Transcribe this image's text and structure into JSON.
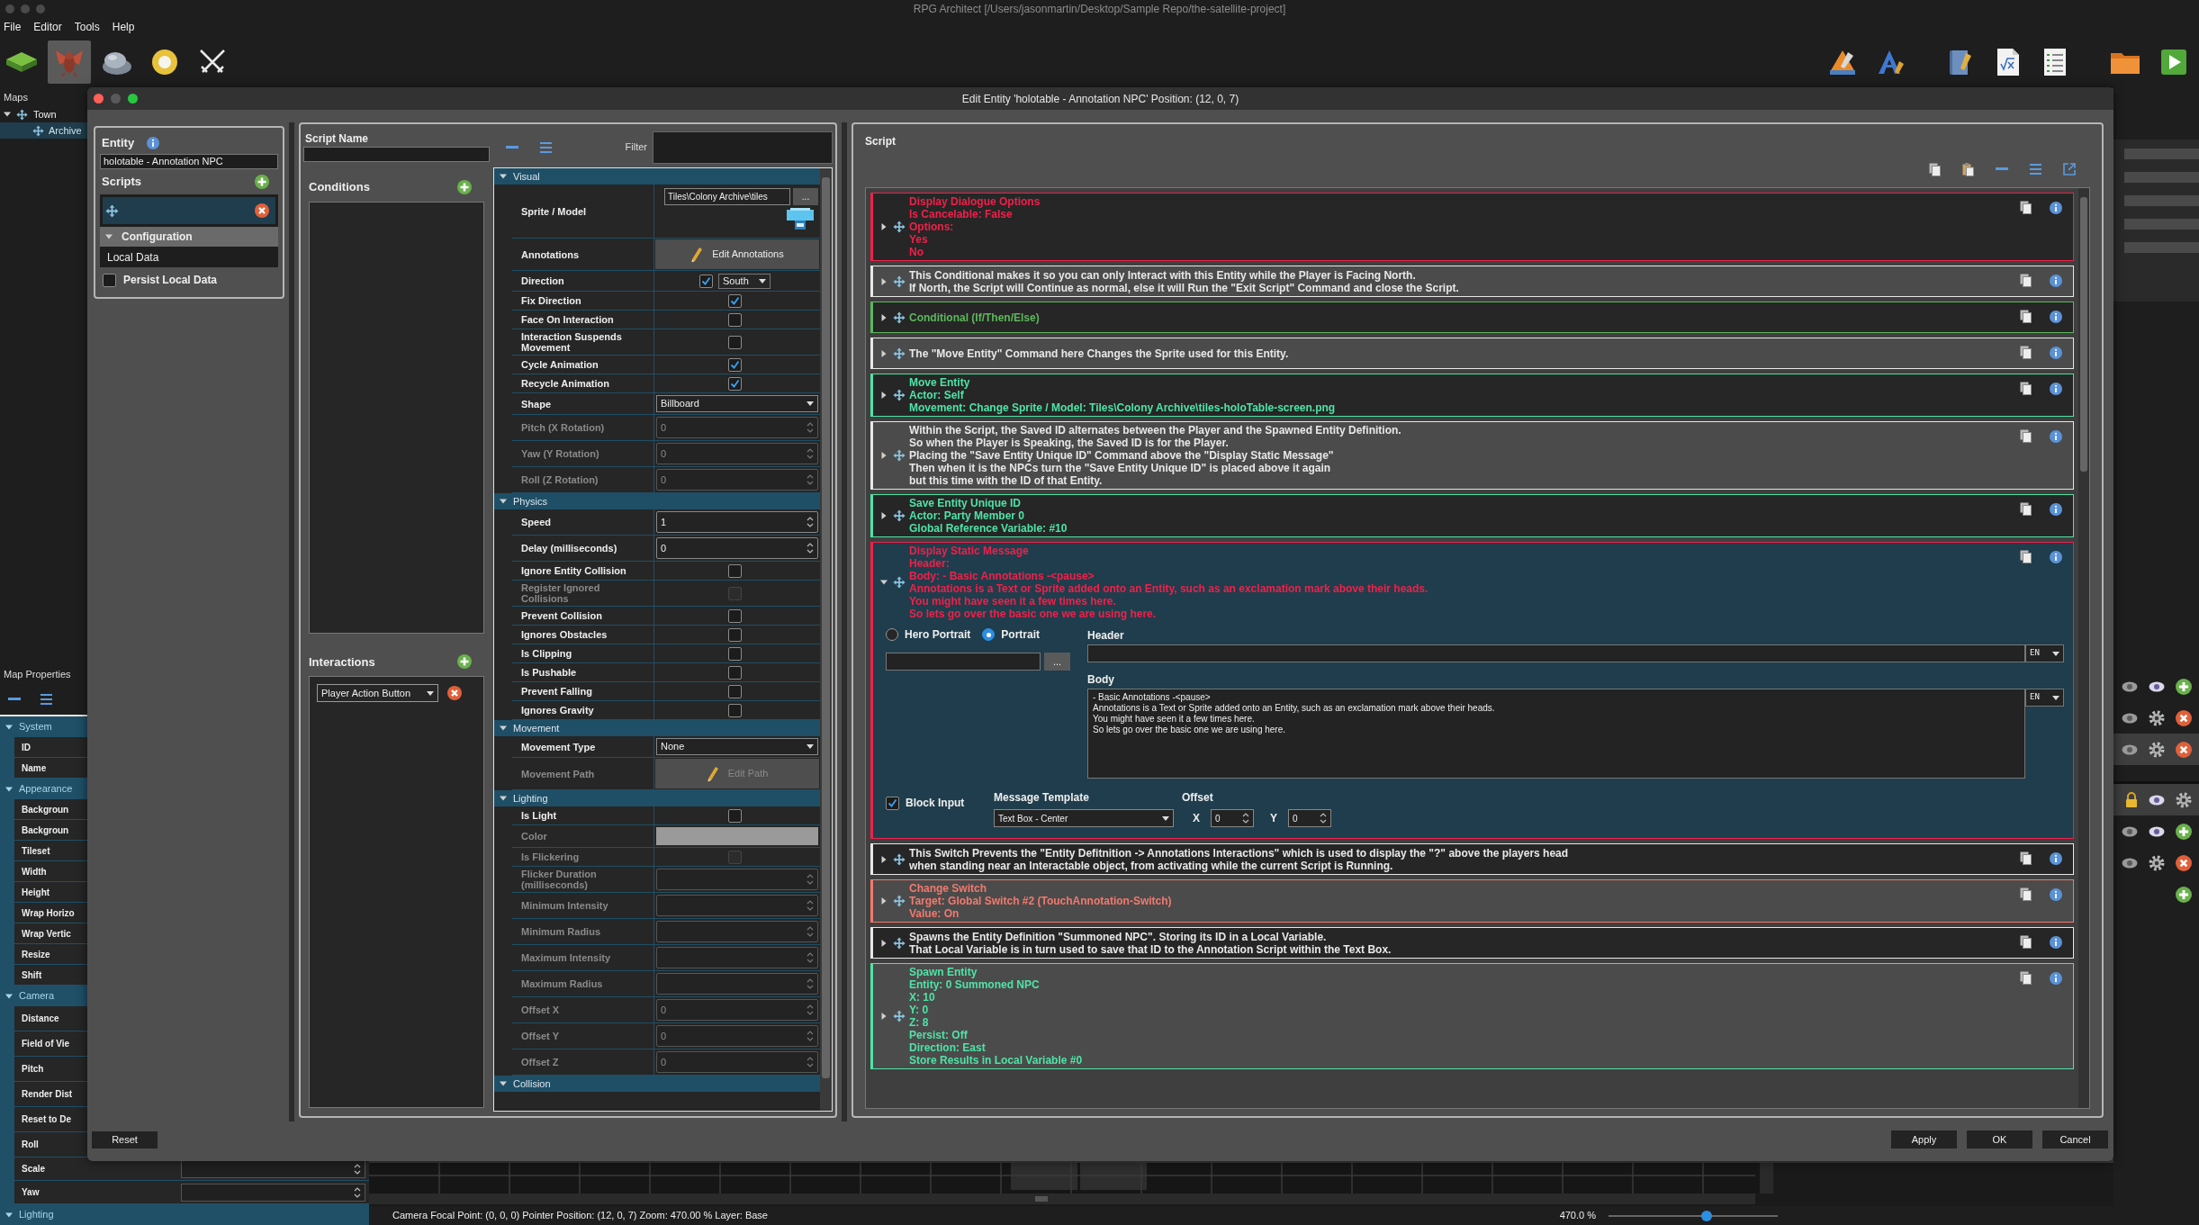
{
  "app": {
    "title": "RPG Architect [/Users/jasonmartin/Desktop/Sample Repo/the-satellite-project]",
    "menu": [
      "File",
      "Editor",
      "Tools",
      "Help"
    ]
  },
  "toolbar": {
    "left": [
      {
        "kind": "tile",
        "selected": false
      },
      {
        "kind": "creature",
        "selected": true
      },
      {
        "kind": "rock",
        "selected": false
      },
      {
        "kind": "ring",
        "selected": false
      },
      {
        "kind": "swords",
        "selected": false
      }
    ],
    "right": [
      {
        "kind": "cone"
      },
      {
        "kind": "triangle"
      },
      {
        "kind": "notebook"
      },
      {
        "kind": "formula"
      },
      {
        "kind": "checklist"
      },
      {
        "kind": "folder"
      },
      {
        "kind": "play"
      }
    ]
  },
  "maps": {
    "title": "Maps",
    "tree": [
      {
        "label": "Town",
        "expanded": true,
        "selected": false,
        "children": [
          {
            "label": "Archive",
            "selected": true
          }
        ]
      }
    ]
  },
  "map_properties": {
    "title": "Map Properties",
    "groups": [
      {
        "label": "System",
        "expanded": true,
        "rows": [
          {
            "label": "ID",
            "kind": "plain"
          },
          {
            "label": "Name",
            "kind": "plain"
          }
        ]
      },
      {
        "label": "Appearance",
        "expanded": true,
        "rows": [
          {
            "label": "Backgroun",
            "kind": "plain"
          },
          {
            "label": "Backgroun",
            "kind": "plain"
          },
          {
            "label": "Tileset",
            "kind": "plain"
          },
          {
            "label": "Width",
            "kind": "plain"
          },
          {
            "label": "Height",
            "kind": "plain"
          },
          {
            "label": "Wrap Horizo",
            "kind": "plain"
          },
          {
            "label": "Wrap Vertic",
            "kind": "plain"
          },
          {
            "label": "Resize",
            "kind": "plain"
          },
          {
            "label": "Shift",
            "kind": "plain"
          }
        ]
      },
      {
        "label": "Camera",
        "expanded": true,
        "rows": [
          {
            "label": "Distance",
            "kind": "tall"
          },
          {
            "label": "Field of Vie",
            "kind": "tall"
          },
          {
            "label": "Pitch",
            "kind": "tall"
          },
          {
            "label": "Render Dist",
            "kind": "tall"
          },
          {
            "label": "Reset to De",
            "kind": "tall"
          },
          {
            "label": "Roll",
            "kind": "tall"
          },
          {
            "label": "Scale",
            "kind": "spin"
          },
          {
            "label": "Yaw",
            "kind": "spin"
          }
        ]
      },
      {
        "label": "Lighting",
        "expanded": true
      }
    ]
  },
  "layers": {
    "groups": [
      {
        "rows": [
          {
            "selected": false,
            "icons": [
              {
                "kind": "eye_off"
              },
              {
                "kind": "eye"
              },
              {
                "kind": "add"
              }
            ]
          },
          {
            "selected": false,
            "icons": [
              {
                "kind": "eye_off"
              },
              {
                "kind": "gear"
              },
              {
                "kind": "remove"
              }
            ]
          },
          {
            "selected": true,
            "icons": [
              {
                "kind": "eye_off"
              },
              {
                "kind": "gear"
              },
              {
                "kind": "remove"
              }
            ]
          }
        ]
      },
      {
        "rows": [
          {
            "selected": true,
            "icons": [
              {
                "kind": "lock"
              },
              {
                "kind": "eye"
              },
              {
                "kind": "gear"
              }
            ]
          },
          {
            "selected": false,
            "icons": [
              {
                "kind": "eye_off"
              },
              {
                "kind": "eye"
              },
              {
                "kind": "add"
              }
            ]
          },
          {
            "selected": false,
            "icons": [
              {
                "kind": "eye_off"
              },
              {
                "kind": "gear"
              },
              {
                "kind": "remove"
              }
            ]
          },
          {
            "selected": false,
            "icons": [
              {
                "kind": "add"
              }
            ]
          }
        ]
      }
    ]
  },
  "dialog": {
    "title": "Edit Entity 'holotable - Annotation NPC' Position: (12, 0, 7)",
    "entity": {
      "label": "Entity",
      "name": "holotable - Annotation NPC",
      "scripts_label": "Scripts",
      "scripts": [
        {
          "selected": true
        }
      ],
      "config": {
        "label": "Configuration",
        "expanded": true,
        "items": [
          {
            "label": "Local Data"
          }
        ]
      },
      "persist": {
        "label": "Persist Local Data",
        "checked": false
      }
    },
    "script_name": {
      "label": "Script Name"
    },
    "conditions": {
      "label": "Conditions"
    },
    "interactions": {
      "label": "Interactions",
      "items": [
        {
          "value": "Player Action Button"
        }
      ]
    },
    "filter": {
      "label": "Filter"
    },
    "properties": [
      {
        "kind": "header",
        "label": "Visual",
        "expanded": true
      },
      {
        "kind": "file",
        "label": "Sprite / Model",
        "value": "Tiles\\Colony Archive\\tiles",
        "button": "...",
        "disabled": false
      },
      {
        "kind": "button",
        "label": "Annotations",
        "button": "Edit Annotations",
        "disabled": false
      },
      {
        "kind": "direction",
        "label": "Direction",
        "checked": true,
        "value": "South",
        "disabled": false
      },
      {
        "kind": "check",
        "label": "Fix Direction",
        "checked": true,
        "disabled": false
      },
      {
        "kind": "check",
        "label": "Face On Interaction",
        "checked": false,
        "disabled": false
      },
      {
        "kind": "check",
        "label": "Interaction Suspends Movement",
        "checked": false,
        "disabled": false
      },
      {
        "kind": "check",
        "label": "Cycle Animation",
        "checked": true,
        "disabled": false
      },
      {
        "kind": "check",
        "label": "Recycle Animation",
        "checked": true,
        "disabled": false
      },
      {
        "kind": "select",
        "label": "Shape",
        "value": "Billboard",
        "disabled": false
      },
      {
        "kind": "number",
        "label": "Pitch (X Rotation)",
        "value": "0",
        "disabled": true
      },
      {
        "kind": "number",
        "label": "Yaw (Y Rotation)",
        "value": "0",
        "disabled": true
      },
      {
        "kind": "number",
        "label": "Roll (Z Rotation)",
        "value": "0",
        "disabled": true
      },
      {
        "kind": "header",
        "label": "Physics",
        "expanded": true
      },
      {
        "kind": "number",
        "label": "Speed",
        "value": "1",
        "disabled": false
      },
      {
        "kind": "number",
        "label": "Delay (milliseconds)",
        "value": "0",
        "disabled": false
      },
      {
        "kind": "check",
        "label": "Ignore Entity Collision",
        "checked": false,
        "disabled": false
      },
      {
        "kind": "check",
        "label": "Register Ignored Collisions",
        "checked": false,
        "disabled": true
      },
      {
        "kind": "check",
        "label": "Prevent Collision",
        "checked": false,
        "disabled": false
      },
      {
        "kind": "check",
        "label": "Ignores Obstacles",
        "checked": false,
        "disabled": false
      },
      {
        "kind": "check",
        "label": "Is Clipping",
        "checked": false,
        "disabled": false
      },
      {
        "kind": "check",
        "label": "Is Pushable",
        "checked": false,
        "disabled": false
      },
      {
        "kind": "check",
        "label": "Prevent Falling",
        "checked": false,
        "disabled": false
      },
      {
        "kind": "check",
        "label": "Ignores Gravity",
        "checked": false,
        "disabled": false
      },
      {
        "kind": "header",
        "label": "Movement",
        "expanded": true
      },
      {
        "kind": "select",
        "label": "Movement Type",
        "value": "None",
        "disabled": false
      },
      {
        "kind": "button",
        "label": "Movement Path",
        "button": "Edit Path",
        "disabled": true
      },
      {
        "kind": "header",
        "label": "Lighting",
        "expanded": true
      },
      {
        "kind": "check",
        "label": "Is Light",
        "checked": false,
        "disabled": false
      },
      {
        "kind": "color",
        "label": "Color",
        "disabled": true
      },
      {
        "kind": "check",
        "label": "Is Flickering",
        "checked": false,
        "disabled": true
      },
      {
        "kind": "number",
        "label": "Flicker Duration (milliseconds)",
        "disabled": true
      },
      {
        "kind": "number",
        "label": "Minimum Intensity",
        "disabled": true
      },
      {
        "kind": "number",
        "label": "Minimum Radius",
        "disabled": true
      },
      {
        "kind": "number",
        "label": "Maximum Intensity",
        "disabled": true
      },
      {
        "kind": "number",
        "label": "Maximum Radius",
        "disabled": true
      },
      {
        "kind": "number",
        "label": "Offset X",
        "value": "0",
        "disabled": true
      },
      {
        "kind": "number",
        "label": "Offset Y",
        "value": "0",
        "disabled": true
      },
      {
        "kind": "number",
        "label": "Offset Z",
        "value": "0",
        "disabled": true
      },
      {
        "kind": "header",
        "label": "Collision",
        "expanded": true
      }
    ],
    "script": {
      "label": "Script",
      "commands": [
        {
          "color": "#f0204a",
          "expanded": false,
          "text": "Display Dialogue Options\nIs Cancelable: False\nOptions:\nYes\nNo"
        },
        {
          "color": "#e8e8e8",
          "expanded": false,
          "text": "This Conditional makes it so you can only Interact with this Entity while the Player is Facing North.\nIf North, the Script will Continue as normal, else it will Run the \"Exit Script\" Command and close the Script."
        },
        {
          "color": "#5cb85c",
          "expanded": false,
          "text": "Conditional (If/Then/Else)"
        },
        {
          "color": "#e8e8e8",
          "expanded": false,
          "text": "The \"Move Entity\" Command here Changes the Sprite used for this Entity."
        },
        {
          "color": "#4fe3a6",
          "expanded": false,
          "text": "Move Entity\nActor: Self\nMovement: Change Sprite / Model: Tiles\\Colony Archive\\tiles-holoTable-screen.png"
        },
        {
          "color": "#e8e8e8",
          "expanded": false,
          "text": "Within the Script, the Saved ID alternates between the Player and the Spawned Entity Definition.\nSo when the Player is Speaking, the Saved ID is for the Player.\nPlacing the \"Save Entity Unique ID\" Command above the \"Display Static Message\"\nThen when it is the NPCs turn the \"Save Entity Unique ID\" is placed above it again\nbut this time with the ID of that Entity."
        },
        {
          "color": "#4fe3a6",
          "expanded": false,
          "text": "Save Entity Unique ID\nActor: Party Member 0\nGlobal Reference Variable: #10"
        },
        {
          "color": "#f0204a",
          "expanded": true,
          "text": "Display Static Message\nHeader:\nBody: - Basic Annotations -<pause>\nAnnotations is a Text or Sprite added onto an Entity, such as an exclamation mark above their heads.\nYou might have seen it a few times here.\nSo lets go over the basic one we are using here.",
          "editor": {
            "portrait_options": [
              {
                "label": "Hero Portrait",
                "selected": false
              },
              {
                "label": "Portrait",
                "selected": true
              }
            ],
            "portrait_button": "...",
            "header_label": "Header",
            "header_lang": "EN",
            "body_label": "Body",
            "body": "- Basic Annotations -<pause>\nAnnotations is a Text or Sprite added onto an Entity, such as an exclamation mark above their heads.\nYou might have seen it a few times here.\nSo lets go over the basic one we are using here.",
            "body_lang": "EN",
            "block_input": {
              "label": "Block Input",
              "checked": true
            },
            "template_label": "Message Template",
            "template": "Text Box - Center",
            "offset_label": "Offset",
            "offset": [
              {
                "axis": "X",
                "value": "0"
              },
              {
                "axis": "Y",
                "value": "0"
              }
            ]
          }
        },
        {
          "color": "#e8e8e8",
          "expanded": false,
          "text": "This Switch Prevents the \"Entity Defitnition -> Annotations Interactions\" which is used to display the \"?\" above the players head\nwhen standing near an Interactable object, from activating while the current Script is Running."
        },
        {
          "color": "#f27a6e",
          "expanded": false,
          "text": "Change Switch\nTarget: Global Switch #2 (TouchAnnotation-Switch)\nValue: On"
        },
        {
          "color": "#e8e8e8",
          "expanded": false,
          "text": "Spawns the Entity Definition \"Summoned NPC\". Storing its ID in a Local Variable.\nThat Local Variable is in turn used to save that ID to the Annotation Script within the Text Box."
        },
        {
          "color": "#4fe3a6",
          "expanded": false,
          "text": "Spawn Entity\nEntity: 0 Summoned NPC\nX: 10\nY: 0\nZ: 8\nPersist: Off\nDirection: East\nStore Results in Local Variable #0"
        }
      ]
    },
    "reset": "Reset",
    "buttons": [
      "Apply",
      "OK",
      "Cancel"
    ]
  },
  "status_bar": {
    "text": "Camera Focal Point: (0, 0, 0) Pointer Position: (12, 0, 7) Zoom: 470.00 % Layer: Base",
    "zoom": "470.0 %",
    "zoom_slider": {
      "level": 0.58
    }
  }
}
